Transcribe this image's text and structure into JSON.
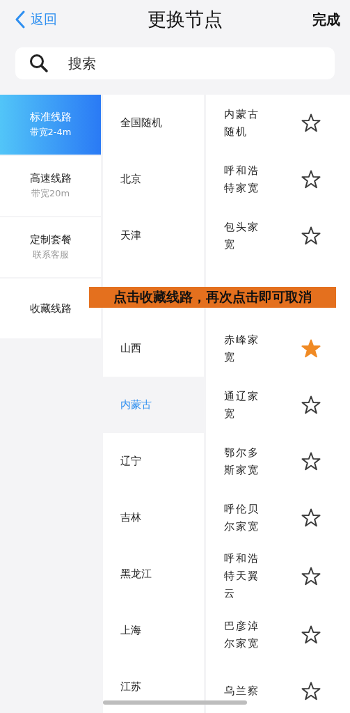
{
  "header": {
    "back": "返回",
    "title": "更换节点",
    "done": "完成"
  },
  "search": {
    "placeholder": "搜索"
  },
  "categories": [
    {
      "label": "标准线路",
      "sub": "带宽2-4m",
      "selected": true
    },
    {
      "label": "高速线路",
      "sub": "带宽20m",
      "selected": false
    },
    {
      "label": "定制套餐",
      "sub": "联系客服",
      "selected": false
    },
    {
      "label": "收藏线路",
      "selected": false
    }
  ],
  "regions": [
    {
      "kind": "region",
      "name": "全国随机",
      "selected": false
    },
    {
      "kind": "region",
      "name": "北京",
      "selected": false
    },
    {
      "kind": "region",
      "name": "天津",
      "selected": false
    },
    {
      "kind": "covered"
    },
    {
      "kind": "region",
      "name": "山西",
      "selected": false
    },
    {
      "kind": "region",
      "name": "内蒙古",
      "selected": true
    },
    {
      "kind": "region",
      "name": "辽宁",
      "selected": false
    },
    {
      "kind": "region",
      "name": "吉林",
      "selected": false
    },
    {
      "kind": "region",
      "name": "黑龙江",
      "selected": false
    },
    {
      "kind": "region",
      "name": "上海",
      "selected": false
    },
    {
      "kind": "region",
      "name": "江苏",
      "selected": false
    }
  ],
  "nodes": [
    {
      "kind": "node",
      "name": "内蒙古随机",
      "starred": false
    },
    {
      "kind": "node",
      "name": "呼和浩特家宽",
      "starred": false
    },
    {
      "kind": "node",
      "name": "包头家宽",
      "starred": false
    },
    {
      "kind": "covered"
    },
    {
      "kind": "node",
      "name": "赤峰家宽",
      "starred": true
    },
    {
      "kind": "node",
      "name": "通辽家宽",
      "starred": false
    },
    {
      "kind": "node",
      "name": "鄂尔多斯家宽",
      "starred": false
    },
    {
      "kind": "node",
      "name": "呼伦贝尔家宽",
      "starred": false
    },
    {
      "kind": "node",
      "name": "呼和浩特天翼云",
      "starred": false
    },
    {
      "kind": "node",
      "name": "巴彦淖尔家宽",
      "starred": false
    },
    {
      "kind": "node",
      "name": "乌兰察",
      "starred": false
    }
  ],
  "caption": "点击收藏线路，再次点击即可取消"
}
